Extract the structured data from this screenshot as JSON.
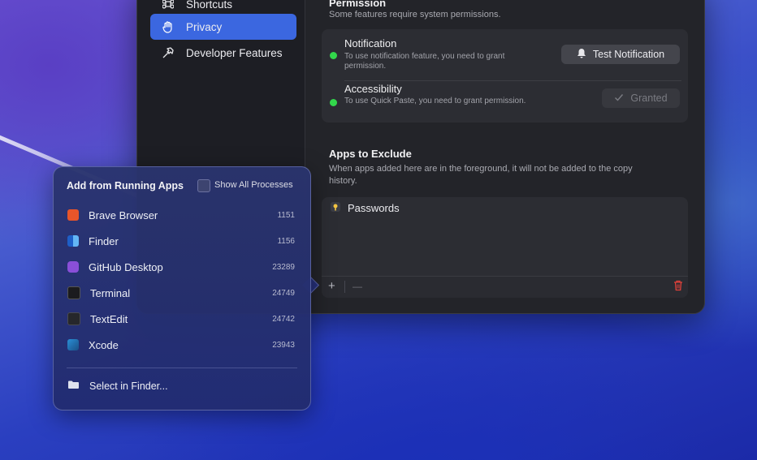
{
  "sidebar": {
    "items": [
      {
        "label": "Shortcuts",
        "icon": "command-icon"
      },
      {
        "label": "Privacy",
        "icon": "hand-icon",
        "active": true
      },
      {
        "label": "Developer Features",
        "icon": "hammer-icon"
      }
    ]
  },
  "permission": {
    "heading": "Permission",
    "subtitle": "Some features require system permissions.",
    "notification": {
      "title": "Notification",
      "desc": "To use notification feature, you need to grant permission.",
      "button": "Test Notification"
    },
    "accessibility": {
      "title": "Accessibility",
      "desc": "To use Quick Paste, you need to grant permission.",
      "button": "Granted"
    }
  },
  "exclude": {
    "heading": "Apps to Exclude",
    "subtitle": "When apps added here are in the foreground, it will not be added to the copy history.",
    "apps": [
      {
        "name": "Passwords"
      }
    ],
    "add_symbol": "+",
    "remove_symbol": "—"
  },
  "popover": {
    "title": "Add from Running Apps",
    "show_all_label": "Show All Processes",
    "apps": [
      {
        "name": "Brave Browser",
        "pid": "1151",
        "color": "#e8552a"
      },
      {
        "name": "Finder",
        "pid": "1156",
        "color": "#2f8ce8"
      },
      {
        "name": "GitHub Desktop",
        "pid": "23289",
        "color": "#8a4fd8"
      },
      {
        "name": "Terminal",
        "pid": "24749",
        "color": "#1b1b1e"
      },
      {
        "name": "TextEdit",
        "pid": "24742",
        "color": "#26272b"
      },
      {
        "name": "Xcode",
        "pid": "23943",
        "color": "#2a8fd6"
      }
    ],
    "select_finder": "Select in Finder..."
  },
  "colors": {
    "accent": "#3b67e0",
    "status_green": "#32d74b",
    "trash_red": "#e0413a"
  }
}
